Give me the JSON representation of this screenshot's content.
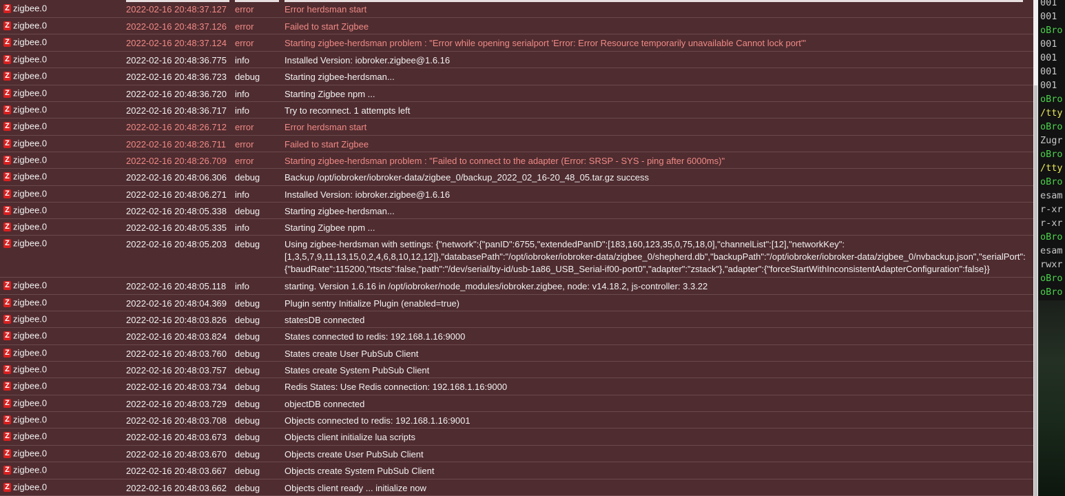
{
  "log": {
    "rows": [
      {
        "source": "zigbee.0",
        "time": "2022-02-16 20:48:37.127",
        "severity": "error",
        "message": "Error herdsman start"
      },
      {
        "source": "zigbee.0",
        "time": "2022-02-16 20:48:37.126",
        "severity": "error",
        "message": "Failed to start Zigbee"
      },
      {
        "source": "zigbee.0",
        "time": "2022-02-16 20:48:37.124",
        "severity": "error",
        "message": "Starting zigbee-herdsman problem : \"Error while opening serialport 'Error: Error Resource temporarily unavailable Cannot lock port'\""
      },
      {
        "source": "zigbee.0",
        "time": "2022-02-16 20:48:36.775",
        "severity": "info",
        "message": "Installed Version: iobroker.zigbee@1.6.16"
      },
      {
        "source": "zigbee.0",
        "time": "2022-02-16 20:48:36.723",
        "severity": "debug",
        "message": "Starting zigbee-herdsman..."
      },
      {
        "source": "zigbee.0",
        "time": "2022-02-16 20:48:36.720",
        "severity": "info",
        "message": "Starting Zigbee npm ..."
      },
      {
        "source": "zigbee.0",
        "time": "2022-02-16 20:48:36.717",
        "severity": "info",
        "message": "Try to reconnect. 1 attempts left"
      },
      {
        "source": "zigbee.0",
        "time": "2022-02-16 20:48:26.712",
        "severity": "error",
        "message": "Error herdsman start"
      },
      {
        "source": "zigbee.0",
        "time": "2022-02-16 20:48:26.711",
        "severity": "error",
        "message": "Failed to start Zigbee"
      },
      {
        "source": "zigbee.0",
        "time": "2022-02-16 20:48:26.709",
        "severity": "error",
        "message": "Starting zigbee-herdsman problem : \"Failed to connect to the adapter (Error: SRSP - SYS - ping after 6000ms)\""
      },
      {
        "source": "zigbee.0",
        "time": "2022-02-16 20:48:06.306",
        "severity": "debug",
        "message": "Backup /opt/iobroker/iobroker-data/zigbee_0/backup_2022_02_16-20_48_05.tar.gz success"
      },
      {
        "source": "zigbee.0",
        "time": "2022-02-16 20:48:06.271",
        "severity": "info",
        "message": "Installed Version: iobroker.zigbee@1.6.16"
      },
      {
        "source": "zigbee.0",
        "time": "2022-02-16 20:48:05.338",
        "severity": "debug",
        "message": "Starting zigbee-herdsman..."
      },
      {
        "source": "zigbee.0",
        "time": "2022-02-16 20:48:05.335",
        "severity": "info",
        "message": "Starting Zigbee npm ..."
      },
      {
        "source": "zigbee.0",
        "time": "2022-02-16 20:48:05.203",
        "severity": "debug",
        "message": "Using zigbee-herdsman with settings: {\"network\":{\"panID\":6755,\"extendedPanID\":[183,160,123,35,0,75,18,0],\"channelList\":[12],\"networkKey\":[1,3,5,7,9,11,13,15,0,2,4,6,8,10,12,12]},\"databasePath\":\"/opt/iobroker/iobroker-data/zigbee_0/shepherd.db\",\"backupPath\":\"/opt/iobroker/iobroker-data/zigbee_0/nvbackup.json\",\"serialPort\":{\"baudRate\":115200,\"rtscts\":false,\"path\":\"/dev/serial/by-id/usb-1a86_USB_Serial-if00-port0\",\"adapter\":\"zstack\"},\"adapter\":{\"forceStartWithInconsistentAdapterConfiguration\":false}}"
      },
      {
        "source": "zigbee.0",
        "time": "2022-02-16 20:48:05.118",
        "severity": "info",
        "message": "starting. Version 1.6.16 in /opt/iobroker/node_modules/iobroker.zigbee, node: v14.18.2, js-controller: 3.3.22"
      },
      {
        "source": "zigbee.0",
        "time": "2022-02-16 20:48:04.369",
        "severity": "debug",
        "message": "Plugin sentry Initialize Plugin (enabled=true)"
      },
      {
        "source": "zigbee.0",
        "time": "2022-02-16 20:48:03.826",
        "severity": "debug",
        "message": "statesDB connected"
      },
      {
        "source": "zigbee.0",
        "time": "2022-02-16 20:48:03.824",
        "severity": "debug",
        "message": "States connected to redis: 192.168.1.16:9000"
      },
      {
        "source": "zigbee.0",
        "time": "2022-02-16 20:48:03.760",
        "severity": "debug",
        "message": "States create User PubSub Client"
      },
      {
        "source": "zigbee.0",
        "time": "2022-02-16 20:48:03.757",
        "severity": "debug",
        "message": "States create System PubSub Client"
      },
      {
        "source": "zigbee.0",
        "time": "2022-02-16 20:48:03.734",
        "severity": "debug",
        "message": "Redis States: Use Redis connection: 192.168.1.16:9000"
      },
      {
        "source": "zigbee.0",
        "time": "2022-02-16 20:48:03.729",
        "severity": "debug",
        "message": "objectDB connected"
      },
      {
        "source": "zigbee.0",
        "time": "2022-02-16 20:48:03.708",
        "severity": "debug",
        "message": "Objects connected to redis: 192.168.1.16:9001"
      },
      {
        "source": "zigbee.0",
        "time": "2022-02-16 20:48:03.673",
        "severity": "debug",
        "message": "Objects client initialize lua scripts"
      },
      {
        "source": "zigbee.0",
        "time": "2022-02-16 20:48:03.670",
        "severity": "debug",
        "message": "Objects create User PubSub Client"
      },
      {
        "source": "zigbee.0",
        "time": "2022-02-16 20:48:03.667",
        "severity": "debug",
        "message": "Objects create System PubSub Client"
      },
      {
        "source": "zigbee.0",
        "time": "2022-02-16 20:48:03.662",
        "severity": "debug",
        "message": "Objects client ready ... initialize now"
      }
    ],
    "icon_letter": "Z",
    "colors": {
      "error_text": "#f08a85",
      "normal_text": "#f2f2f2",
      "background": "#4f2c30",
      "icon": "#d92020"
    }
  },
  "terminal": {
    "lines": [
      {
        "text": "001",
        "color": "dim"
      },
      {
        "text": "001",
        "color": "dim"
      },
      {
        "text": "oBro",
        "color": "green"
      },
      {
        "text": "001",
        "color": "dim"
      },
      {
        "text": "001",
        "color": "dim"
      },
      {
        "text": "001",
        "color": "dim"
      },
      {
        "text": "001",
        "color": "dim"
      },
      {
        "text": "oBro",
        "color": "green"
      },
      {
        "text": "/tty",
        "color": "yellow"
      },
      {
        "text": "oBro",
        "color": "green"
      },
      {
        "text": "Zugr",
        "color": "dim"
      },
      {
        "text": "oBro",
        "color": "green"
      },
      {
        "text": "/tty",
        "color": "yellow"
      },
      {
        "text": "oBro",
        "color": "green"
      },
      {
        "text": "esam",
        "color": "dim"
      },
      {
        "text": "r-xr",
        "color": "dim"
      },
      {
        "text": "r-xr",
        "color": "dim"
      },
      {
        "text": "oBro",
        "color": "green"
      },
      {
        "text": "esam",
        "color": "dim"
      },
      {
        "text": "rwxr",
        "color": "dim"
      },
      {
        "text": "oBro",
        "color": "green"
      },
      {
        "text": "oBro",
        "color": "green"
      }
    ]
  }
}
